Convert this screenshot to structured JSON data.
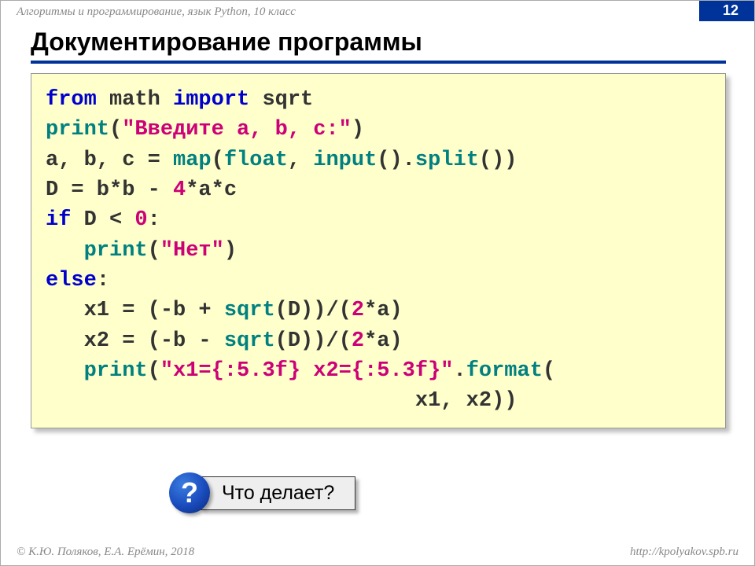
{
  "header": {
    "course": "Алгоритмы и программирование, язык Python, 10 класс",
    "page": "12"
  },
  "title": "Документирование программы",
  "code": {
    "l1": {
      "a": "from",
      "b": " math ",
      "c": "import",
      "d": " sqrt"
    },
    "l2": {
      "a": "print",
      "b": "(",
      "c": "\"Введите a, b, c:\"",
      "d": ")"
    },
    "l3": {
      "a": "a, b, c = ",
      "b": "map",
      "c": "(",
      "d": "float",
      "e": ", ",
      "f": "input",
      "g": "().",
      "h": "split",
      "i": "())"
    },
    "l4": {
      "a": "D = b*b - ",
      "b": "4",
      "c": "*a*c"
    },
    "l5": {
      "a": "if",
      "b": " D < ",
      "c": "0",
      "d": ":"
    },
    "l6": {
      "a": "   ",
      "b": "print",
      "c": "(",
      "d": "\"Нет\"",
      "e": ")"
    },
    "l7": {
      "a": "else",
      "b": ":"
    },
    "l8": {
      "a": "   x1 = (-b + ",
      "b": "sqrt",
      "c": "(D))/(",
      "d": "2",
      "e": "*a)"
    },
    "l9": {
      "a": "   x2 = (-b - ",
      "b": "sqrt",
      "c": "(D))/(",
      "d": "2",
      "e": "*a)"
    },
    "l10": {
      "a": "   ",
      "b": "print",
      "c": "(",
      "d": "\"x1={:5.3f} x2={:5.3f}\"",
      "e": ".",
      "f": "format",
      "g": "("
    },
    "l11": {
      "a": "                             x1, x2))"
    }
  },
  "question": {
    "mark": "?",
    "text": "Что делает?"
  },
  "footer": {
    "left": "© К.Ю. Поляков, Е.А. Ерёмин, 2018",
    "right": "http://kpolyakov.spb.ru"
  }
}
